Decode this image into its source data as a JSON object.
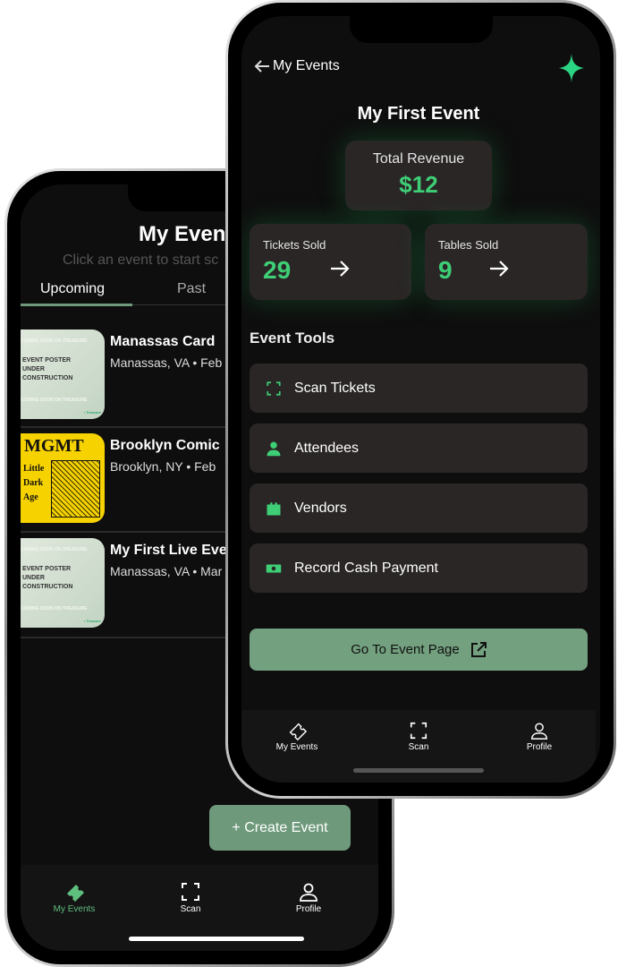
{
  "back_phone": {
    "title": "My Even",
    "subtitle": "Click an event to start sc",
    "tabs": [
      {
        "label": "Upcoming",
        "active": true
      },
      {
        "label": "Past",
        "active": false
      }
    ],
    "events": [
      {
        "title": "Manassas Card",
        "subtitle": "Manassas, VA • Feb",
        "poster": {
          "top": "COMING SOON ON TREASURE",
          "body": "EVENT POSTER UNDER CONSTRUCTION",
          "bottom": "COMING SOON ON TREASURE",
          "brand": "• Treasure"
        }
      },
      {
        "title": "Brooklyn Comic",
        "subtitle": "Brooklyn, NY • Feb",
        "poster": {
          "headline": "MGMT",
          "body": "Little Dark Age"
        }
      },
      {
        "title": "My First Live Eve",
        "subtitle": "Manassas, VA • Mar",
        "poster": {
          "top": "COMING SOON ON TREASURE",
          "body": "EVENT POSTER UNDER CONSTRUCTION",
          "bottom": "COMING SOON ON TREASURE",
          "brand": "• Treasure"
        }
      }
    ],
    "create_button": "+ Create Event",
    "tabbar": [
      {
        "label": "My Events",
        "icon": "ticket-icon",
        "active": true
      },
      {
        "label": "Scan",
        "icon": "scan-icon"
      },
      {
        "label": "Profile",
        "icon": "person-icon"
      }
    ]
  },
  "front_phone": {
    "back_label": "My Events",
    "logo_icon": "sparkle-icon",
    "title": "My First Event",
    "revenue": {
      "label": "Total Revenue",
      "value": "$12"
    },
    "tickets": {
      "label": "Tickets Sold",
      "value": "29"
    },
    "tables": {
      "label": "Tables Sold",
      "value": "9"
    },
    "tools_heading": "Event Tools",
    "tools": [
      {
        "label": "Scan Tickets",
        "icon": "scan-icon"
      },
      {
        "label": "Attendees",
        "icon": "person-icon"
      },
      {
        "label": "Vendors",
        "icon": "store-icon"
      },
      {
        "label": "Record Cash Payment",
        "icon": "cash-icon"
      }
    ],
    "event_page_button": "Go To Event Page",
    "tabbar": [
      {
        "label": "My Events",
        "icon": "ticket-icon"
      },
      {
        "label": "Scan",
        "icon": "scan-icon"
      },
      {
        "label": "Profile",
        "icon": "person-icon"
      }
    ]
  },
  "colors": {
    "accent": "#3ecf76",
    "button": "#73a07f",
    "card": "#2a2626",
    "background": "#0e0e0e"
  }
}
